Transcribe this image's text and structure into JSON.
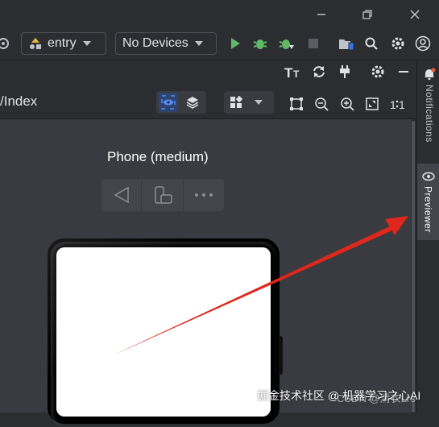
{
  "toolbar": {
    "entry_label": "entry",
    "device_label": "No Devices"
  },
  "editor": {
    "file_label": "/Index"
  },
  "previewer": {
    "device_name": "Phone (medium)"
  },
  "sidebar": {
    "notifications_label": "Notifications",
    "previewer_label": "Previewer"
  },
  "watermark": {
    "text": "掘金技术社区 @ 机器学习之心AI",
    "overlay_text": "CSDN @清衣Lrs"
  },
  "colors": {
    "accent_green": "#5fb865",
    "arrow_red": "#e0271b",
    "brand_blue": "#3574f0"
  }
}
